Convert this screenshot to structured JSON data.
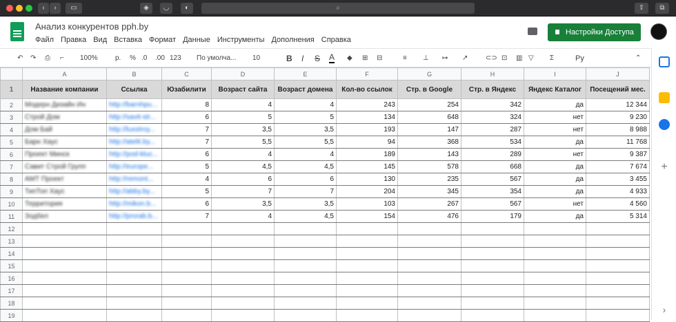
{
  "document": {
    "title": "Анализ конкурентов pph.by"
  },
  "menu": [
    "Файл",
    "Правка",
    "Вид",
    "Вставка",
    "Формат",
    "Данные",
    "Инструменты",
    "Дополнения",
    "Справка"
  ],
  "share_label": "Настройки Доступа",
  "toolbar": {
    "zoom": "100%",
    "currency": "р.",
    "percent": "%",
    "dec_less": ".0",
    "dec_more": ".00",
    "more_formats": "123",
    "font": "По умолча...",
    "font_size": "10",
    "bold": "B",
    "italic": "I",
    "strike": "S",
    "text_color": "A",
    "input_tool": "Ру"
  },
  "columns": [
    "A",
    "B",
    "C",
    "D",
    "E",
    "F",
    "G",
    "H",
    "I",
    "J"
  ],
  "header": [
    "Название компании",
    "Ссылка",
    "Юзабилити",
    "Возраст сайта",
    "Возраст домена",
    "Кол-во ссылок",
    "Стр. в Google",
    "Стр. в Яндекс",
    "Яндекс Каталог",
    "Посещений мес."
  ],
  "rows": [
    [
      "Модерн Дизайн Ин",
      "http://barnhpu...",
      "8",
      "4",
      "4",
      "243",
      "254",
      "342",
      "да",
      "12 344"
    ],
    [
      "Строй Дом",
      "http://savit-str...",
      "6",
      "5",
      "5",
      "134",
      "648",
      "324",
      "нет",
      "9 230"
    ],
    [
      "Дом Бай",
      "http://luxstroy...",
      "7",
      "3,5",
      "3,5",
      "193",
      "147",
      "287",
      "нет",
      "8 988"
    ],
    [
      "Барн Хаус",
      "http://atelit.by...",
      "7",
      "5,5",
      "5,5",
      "94",
      "368",
      "534",
      "да",
      "11 768"
    ],
    [
      "Проект Минск",
      "http://pod-kluc...",
      "6",
      "4",
      "4",
      "189",
      "143",
      "289",
      "нет",
      "9 387"
    ],
    [
      "Савит Строй Групп",
      "http://europe...",
      "5",
      "4,5",
      "4,5",
      "145",
      "578",
      "668",
      "да",
      "7 674"
    ],
    [
      "АМТ Проект",
      "http://remont...",
      "4",
      "6",
      "6",
      "130",
      "235",
      "567",
      "да",
      "3 455"
    ],
    [
      "ТипТоп Хаус",
      "http://abby.by...",
      "5",
      "7",
      "7",
      "204",
      "345",
      "354",
      "да",
      "4 933"
    ],
    [
      "Территория",
      "http://mikon.b...",
      "6",
      "3,5",
      "3,5",
      "103",
      "267",
      "567",
      "нет",
      "4 560"
    ],
    [
      "Зодбел",
      "http://prorab.b...",
      "7",
      "4",
      "4,5",
      "154",
      "476",
      "179",
      "да",
      "5 314"
    ]
  ],
  "empty_rows": [
    "12",
    "13",
    "14",
    "15",
    "16",
    "17",
    "18",
    "19"
  ]
}
